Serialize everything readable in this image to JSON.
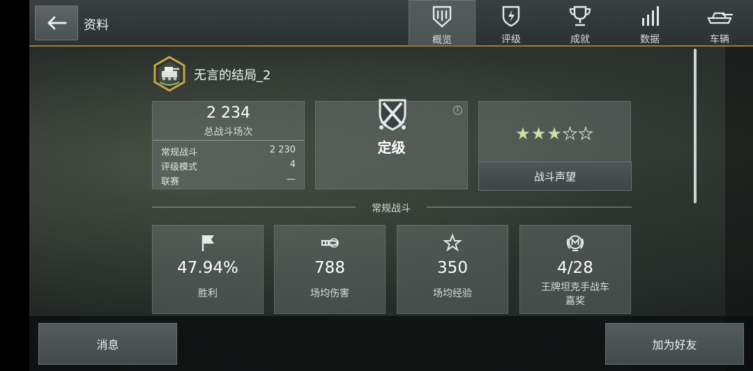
{
  "header": {
    "title": "资料",
    "tabs": [
      {
        "label": "概览",
        "icon": "shield-tier-icon",
        "active": true
      },
      {
        "label": "评级",
        "icon": "rating-shield-icon",
        "active": false
      },
      {
        "label": "成就",
        "icon": "trophy-icon",
        "active": false
      },
      {
        "label": "数据",
        "icon": "bar-chart-icon",
        "active": false
      },
      {
        "label": "车辆",
        "icon": "tank-icon",
        "active": false
      }
    ]
  },
  "player": {
    "name": "无言的结局_2",
    "badge_icon": "clan-badge-icon"
  },
  "battles": {
    "total": "2 234",
    "total_label": "总战斗场次",
    "rows": [
      {
        "label": "常规战斗",
        "value": "2 230"
      },
      {
        "label": "评级模式",
        "value": "4"
      },
      {
        "label": "联赛",
        "value": "—"
      }
    ]
  },
  "rating": {
    "status": "定级",
    "emblem_icon": "crossed-swords-shield-icon",
    "info_icon": "info-icon"
  },
  "reputation": {
    "stars_filled": 3,
    "stars_total": 5,
    "button_label": "战斗声望"
  },
  "section": {
    "label": "常规战斗"
  },
  "stats": [
    {
      "icon": "flag-icon",
      "value": "47.94%",
      "label": "胜利"
    },
    {
      "icon": "damage-shell-icon",
      "value": "788",
      "label": "场均伤害"
    },
    {
      "icon": "star-outline-icon",
      "value": "350",
      "label": "场均经验"
    },
    {
      "icon": "mastery-badge-icon",
      "value": "4/28",
      "label": "王牌坦克手战车\n嘉奖"
    }
  ],
  "footer": {
    "left_label": "消息",
    "right_label": "加为好友"
  },
  "colors": {
    "accent_line": "#a27a3b",
    "star_filled": "#c7e3a7",
    "badge_gold": "#c9a447"
  }
}
